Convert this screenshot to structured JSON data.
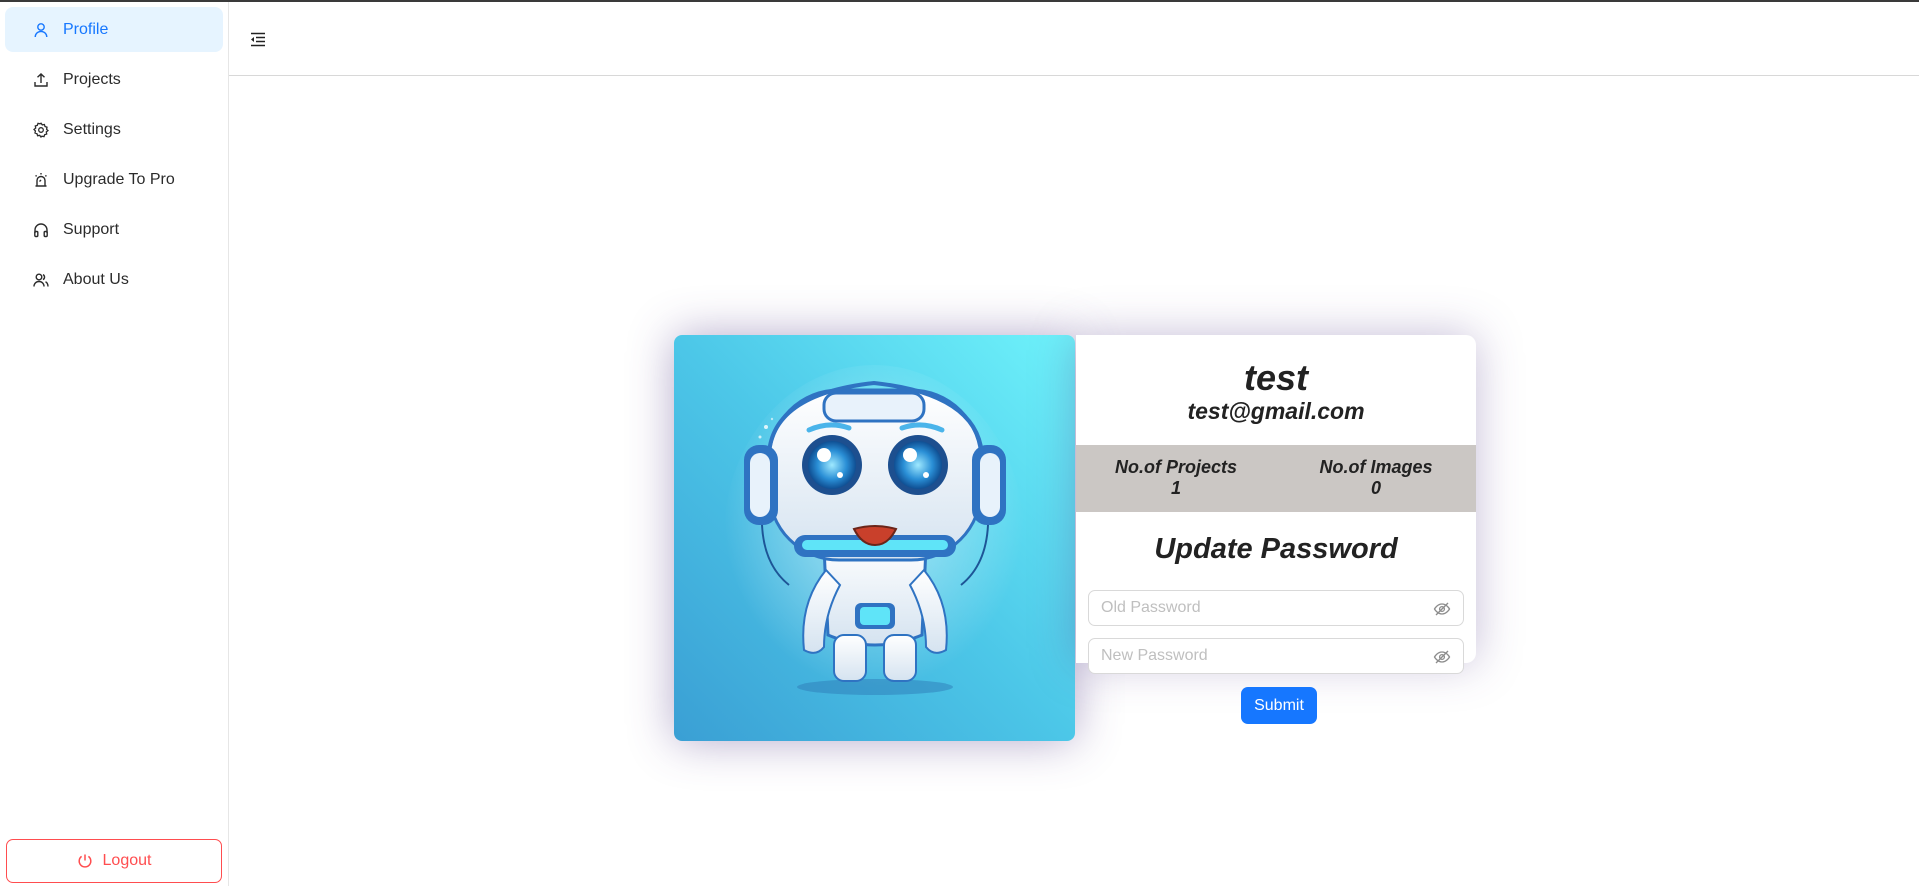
{
  "sidebar": {
    "items": [
      {
        "label": "Profile",
        "icon": "user-icon",
        "active": true
      },
      {
        "label": "Projects",
        "icon": "upload-icon",
        "active": false
      },
      {
        "label": "Settings",
        "icon": "gear-icon",
        "active": false
      },
      {
        "label": "Upgrade To Pro",
        "icon": "alarm-icon",
        "active": false
      },
      {
        "label": "Support",
        "icon": "headphones-icon",
        "active": false
      },
      {
        "label": "About Us",
        "icon": "team-icon",
        "active": false
      }
    ],
    "logout_label": "Logout"
  },
  "header": {
    "collapse_icon": "menu-fold-icon"
  },
  "profile": {
    "avatar": "robot-avatar-with-headphones",
    "name": "test",
    "email": "test@gmail.com",
    "stats": {
      "projects_label": "No.of Projects",
      "projects_value": "1",
      "images_label": "No.of Images",
      "images_value": "0"
    },
    "update_password": {
      "title": "Update Password",
      "old_placeholder": "Old Password",
      "new_placeholder": "New Password",
      "submit_label": "Submit"
    }
  },
  "colors": {
    "accent": "#1677ff",
    "active_bg": "#e6f4ff",
    "danger": "#ff4d4f",
    "stats_bg": "#cbc7c4"
  }
}
